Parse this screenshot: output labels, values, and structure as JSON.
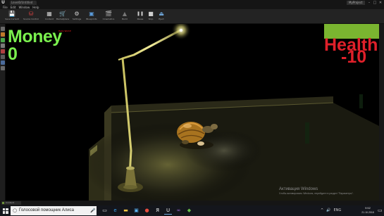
{
  "window": {
    "logo": "U",
    "level_tab": "Level0/Untitled",
    "project": "MyProject",
    "controls": [
      "–",
      "□",
      "✕"
    ]
  },
  "menu": [
    "File",
    "Edit",
    "Window",
    "Help"
  ],
  "toolbar": [
    {
      "label": "Save Current",
      "icon": "save-icon",
      "glyph": "💾"
    },
    {
      "label": "Source Control",
      "icon": "source-control-icon",
      "glyph": "⛁"
    },
    {
      "label": "Content",
      "icon": "content-icon",
      "glyph": "▦"
    },
    {
      "label": "Marketplace",
      "icon": "marketplace-icon",
      "glyph": "🛒"
    },
    {
      "label": "Settings",
      "icon": "settings-icon",
      "glyph": "⚙"
    },
    {
      "label": "Blueprints",
      "icon": "blueprints-icon",
      "glyph": "▣"
    },
    {
      "label": "Cinematics",
      "icon": "cinematics-icon",
      "glyph": "🎬"
    },
    {
      "label": "Build",
      "icon": "build-icon",
      "glyph": "▲"
    },
    {
      "label": "Pause",
      "icon": "pause-icon",
      "glyph": "❚❚"
    },
    {
      "label": "Stop",
      "icon": "stop-icon",
      "glyph": "■"
    },
    {
      "label": "Eject",
      "icon": "eject-icon",
      "glyph": "⏏"
    }
  ],
  "hud": {
    "money_label": "Money",
    "money_value": "0",
    "health_label": "Health",
    "health_value": "-10",
    "debug": "Hello World!"
  },
  "watermark": {
    "title": "Активация Windows",
    "subtitle": "Чтобы активировать Windows, перейдите в раздел \"Параметры\"."
  },
  "bottom_tab": "Content Browser",
  "taskbar": {
    "search_placeholder": "Голосовой помощник Алиса",
    "apps": [
      {
        "icon": "task-view-icon",
        "glyph": "▭",
        "color": "#dddddd"
      },
      {
        "icon": "edge-icon",
        "glyph": "e",
        "color": "#3aa0e8"
      },
      {
        "icon": "file-explorer-icon",
        "glyph": "▬",
        "color": "#f4c542"
      },
      {
        "icon": "store-icon",
        "glyph": "▣",
        "color": "#5ab0f0"
      },
      {
        "icon": "chrome-icon",
        "glyph": "●",
        "color": "#e84c3d"
      },
      {
        "icon": "yandex-icon",
        "glyph": "Я",
        "color": "#f0f0f0"
      },
      {
        "icon": "unreal-icon",
        "glyph": "U",
        "color": "#e8e8e8"
      },
      {
        "icon": "visual-studio-icon",
        "glyph": "∞",
        "color": "#a06ad8"
      },
      {
        "icon": "app-icon",
        "glyph": "◆",
        "color": "#6abf4b"
      }
    ],
    "tray": [
      "^",
      "🔊",
      "ENG"
    ],
    "time": "9:52",
    "date": "21.10.2018"
  },
  "colors": {
    "money": "#7af04e",
    "health": "#e0202a",
    "lamp_light": "#f5f08a",
    "green_box": "#7ab530"
  }
}
